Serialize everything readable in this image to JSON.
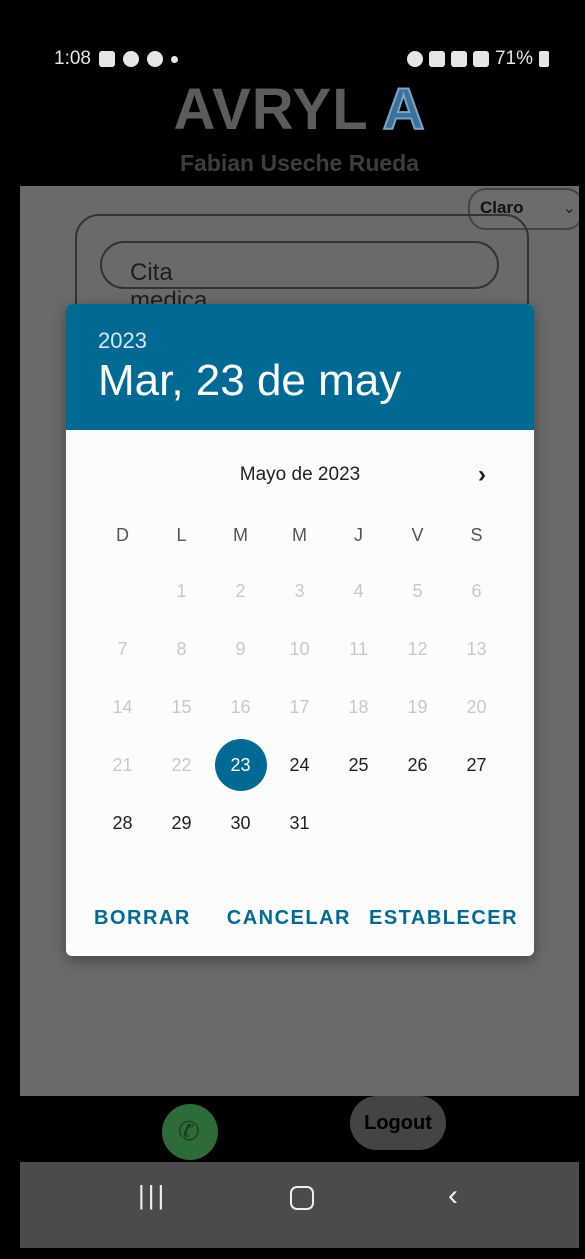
{
  "statusbar": {
    "time": "1:08",
    "battery": "71%"
  },
  "app": {
    "brand": "AVRYL",
    "brand_logo": "A",
    "user_name": "Fabian Useche Rueda",
    "theme_select": "Claro",
    "event_title": "Cita medica"
  },
  "datepicker": {
    "year": "2023",
    "selected_label": "Mar, 23 de may",
    "month_label": "Mayo de 2023",
    "weekdays": [
      "D",
      "L",
      "M",
      "M",
      "J",
      "V",
      "S"
    ],
    "weeks": [
      [
        "",
        "1",
        "2",
        "3",
        "4",
        "5",
        "6"
      ],
      [
        "7",
        "8",
        "9",
        "10",
        "11",
        "12",
        "13"
      ],
      [
        "14",
        "15",
        "16",
        "17",
        "18",
        "19",
        "20"
      ],
      [
        "21",
        "22",
        "23",
        "24",
        "25",
        "26",
        "27"
      ],
      [
        "28",
        "29",
        "30",
        "31",
        "",
        "",
        ""
      ]
    ],
    "buttons": {
      "clear": "BORRAR",
      "cancel": "CANCELAR",
      "set": "ESTABLECER"
    }
  },
  "footer": {
    "logout": "Logout"
  },
  "colors": {
    "accent": "#006a94",
    "dialog_bg": "#fcfcfc",
    "scrim": "#6a6a6a"
  },
  "icons": [
    "gallery-icon",
    "chrome-icon",
    "alarm-icon",
    "mute-icon",
    "wifi-icon",
    "signal-icon",
    "battery-icon",
    "whatsapp-icon",
    "recent-apps-icon",
    "home-icon",
    "back-icon",
    "chevron-right-icon",
    "dropdown-chevron-icon"
  ]
}
